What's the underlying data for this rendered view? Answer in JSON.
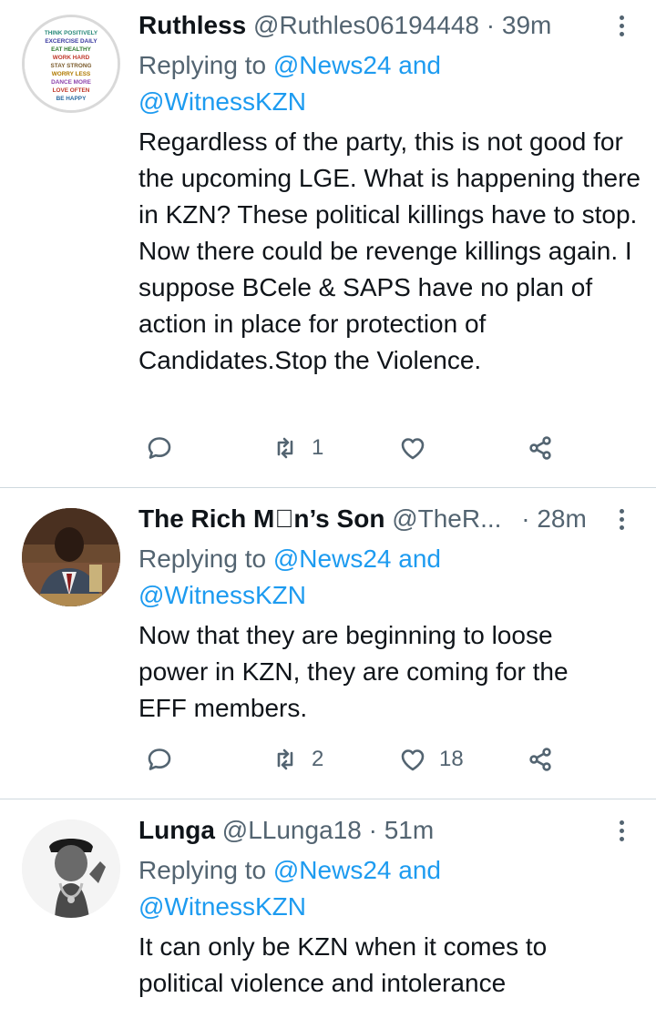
{
  "tweets": [
    {
      "display_name": "Ruthless",
      "handle": "@Ruthles06194448",
      "separator": "·",
      "time": "39m",
      "replying_prefix": "Replying to",
      "reply_mention_1": "@News24",
      "reply_and": "and",
      "reply_mention_2": "@WitnessKZN",
      "text": "Regardless of the party, this is not good for the upcoming LGE. What is happening there in KZN? These political killings have to stop. Now there could be revenge killings again. I suppose BCele & SAPS have no plan of action in place for protection of Candidates.Stop the Violence.",
      "reply_count": "",
      "retweet_count": "1",
      "like_count": "",
      "avatar_text": [
        "THINK POSITIVELY",
        "EXCERCISE DAILY",
        "EAT HEALTHY",
        "WORK HARD",
        "STAY STRONG",
        "WORRY LESS",
        "DANCE MORE",
        "LOVE OFTEN",
        "BE HAPPY"
      ]
    },
    {
      "display_name": "The Rich Mn’s Son",
      "handle": "@TheR...",
      "separator": "·",
      "time": "28m",
      "replying_prefix": "Replying to",
      "reply_mention_1": "@News24",
      "reply_and": "and",
      "reply_mention_2": "@WitnessKZN",
      "text": "Now that they are beginning to loose power in KZN, they are coming for the EFF members.",
      "reply_count": "",
      "retweet_count": "2",
      "like_count": "18"
    },
    {
      "display_name": "Lunga",
      "handle": "@LLunga18",
      "separator": "·",
      "time": "51m",
      "replying_prefix": "Replying to",
      "reply_mention_1": "@News24",
      "reply_and": "and",
      "reply_mention_2": "@WitnessKZN",
      "text": "It can only be KZN when it comes to political violence and intolerance"
    }
  ],
  "icons": {
    "reply": "reply-icon",
    "retweet": "retweet-icon",
    "like": "heart-icon",
    "share": "share-icon",
    "more": "more-vertical-icon"
  },
  "colors": {
    "text": "#0f1419",
    "secondary": "#536471",
    "link": "#1d9bf0",
    "divider": "#cfd9de"
  }
}
